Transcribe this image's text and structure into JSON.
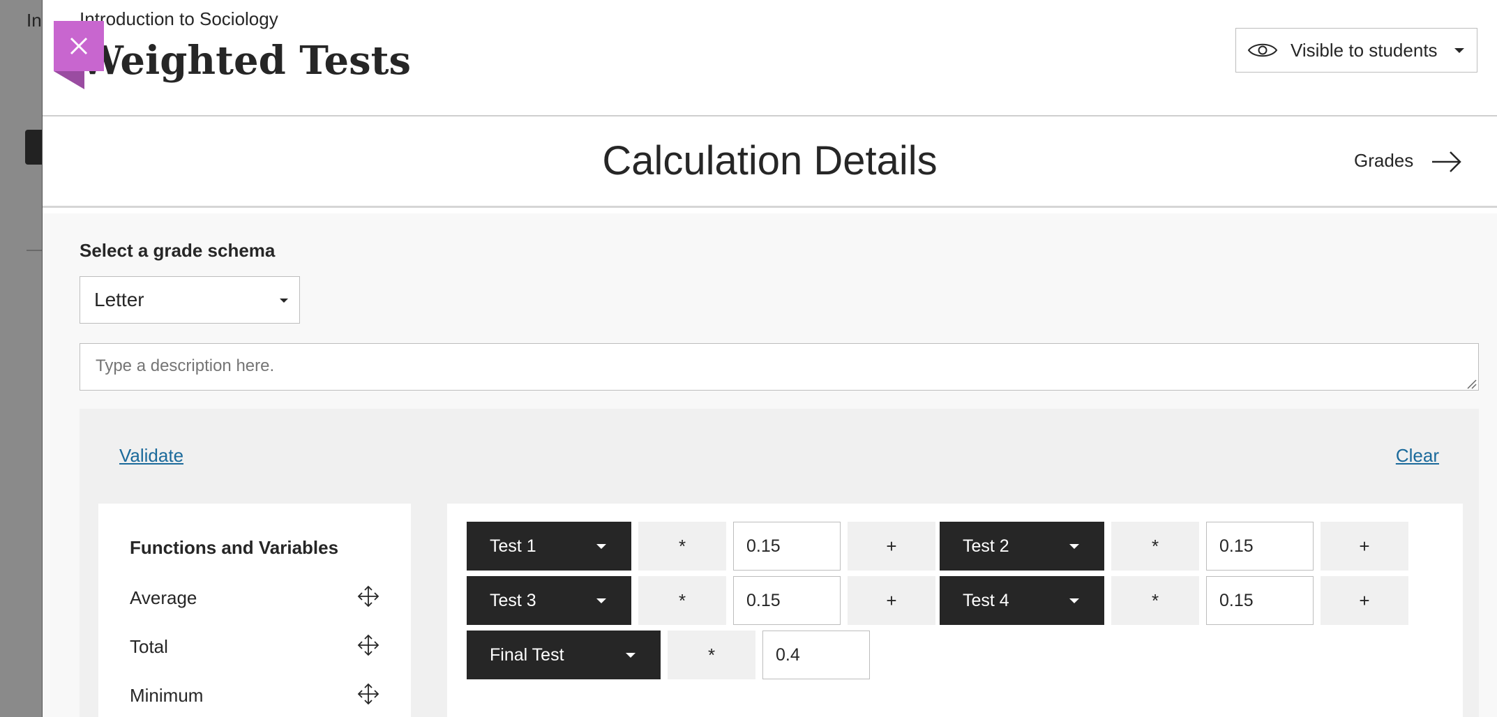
{
  "background": {
    "letters": "In"
  },
  "header": {
    "course_name": "Introduction to Sociology",
    "title": "Weighted Tests",
    "visibility_label": "Visible to students"
  },
  "subheader": {
    "title": "Calculation Details",
    "grades_link": "Grades"
  },
  "schema": {
    "label": "Select a grade schema",
    "selected": "Letter"
  },
  "description": {
    "placeholder": "Type a description here."
  },
  "formula": {
    "validate_label": "Validate",
    "clear_label": "Clear",
    "functions_heading": "Functions and Variables",
    "functions": [
      "Average",
      "Total",
      "Minimum"
    ],
    "terms": [
      {
        "variable": "Test 1",
        "operator": "*",
        "weight": "0.15",
        "join": "+"
      },
      {
        "variable": "Test 2",
        "operator": "*",
        "weight": "0.15",
        "join": "+"
      },
      {
        "variable": "Test 3",
        "operator": "*",
        "weight": "0.15",
        "join": "+"
      },
      {
        "variable": "Test 4",
        "operator": "*",
        "weight": "0.15",
        "join": "+"
      },
      {
        "variable": "Final Test",
        "operator": "*",
        "weight": "0.4"
      }
    ]
  },
  "colors": {
    "accent": "#c866cf",
    "link": "#1b6a9b",
    "variable_bg": "#262626"
  }
}
